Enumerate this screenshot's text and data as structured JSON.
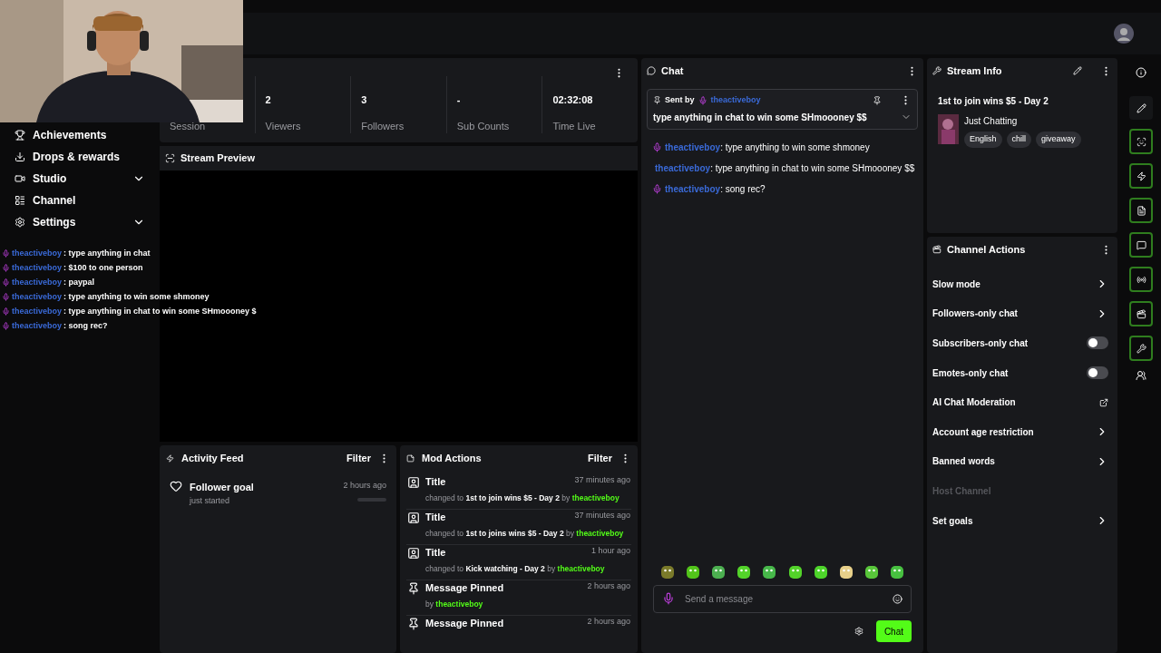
{
  "sidebar": {
    "items": [
      {
        "label": "Achievements",
        "expandable": false
      },
      {
        "label": "Drops & rewards",
        "expandable": false
      },
      {
        "label": "Studio",
        "expandable": true
      },
      {
        "label": "Channel",
        "expandable": false
      },
      {
        "label": "Settings",
        "expandable": true
      }
    ]
  },
  "overlay_chat": [
    {
      "user": "theactiveboy",
      "text": ": type anything in chat"
    },
    {
      "user": "theactiveboy",
      "text": ": $100 to one person"
    },
    {
      "user": "theactiveboy",
      "text": ": paypal"
    },
    {
      "user": "theactiveboy",
      "text": ": type anything to win some shmoney"
    },
    {
      "user": "theactiveboy",
      "text": ": type anything in chat to win some SHmoooney $"
    },
    {
      "user": "theactiveboy",
      "text": ": song rec?"
    }
  ],
  "stats": [
    {
      "label": "Session"
    },
    {
      "value": "2",
      "label": "Viewers"
    },
    {
      "value": "3",
      "label": "Followers"
    },
    {
      "value": "-",
      "label": "Sub Counts"
    },
    {
      "value": "02:32:08",
      "label": "Time Live"
    }
  ],
  "stream_preview": {
    "title": "Stream Preview"
  },
  "activity_feed": {
    "title": "Activity Feed",
    "filter": "Filter",
    "items": [
      {
        "title": "Follower goal",
        "subtitle": "just started",
        "time": "2 hours ago"
      }
    ]
  },
  "mod_actions": {
    "title": "Mod Actions",
    "filter": "Filter",
    "items": [
      {
        "kind": "title_change",
        "title": "Title",
        "time": "37 minutes ago",
        "prefix": "changed to",
        "value": "1st to join wins $5 - Day 2",
        "by": "by",
        "user": "theactiveboy"
      },
      {
        "kind": "title_change",
        "title": "Title",
        "time": "37 minutes ago",
        "prefix": "changed to",
        "value": "1st to joins wins $5 - Day 2",
        "by": "by",
        "user": "theactiveboy"
      },
      {
        "kind": "title_change",
        "title": "Title",
        "time": "1 hour ago",
        "prefix": "changed to",
        "value": "Kick watching - Day 2",
        "by": "by",
        "user": "theactiveboy"
      },
      {
        "kind": "pin",
        "title": "Message Pinned",
        "time": "2 hours ago",
        "by": "by",
        "user": "theactiveboy"
      },
      {
        "kind": "pin",
        "title": "Message Pinned",
        "time": "2 hours ago"
      }
    ]
  },
  "chat": {
    "title": "Chat",
    "pinned": {
      "label": "Sent by",
      "user": "theactiveboy",
      "text": "type anything in chat to win some SHmoooney $$"
    },
    "messages": [
      {
        "user": "theactiveboy",
        "text": ": type anything to win some shmoney"
      },
      {
        "user": "theactiveboy",
        "text": ": type anything in chat to win some SHmoooney $$"
      },
      {
        "user": "theactiveboy",
        "text": ": song rec?"
      }
    ],
    "input": {
      "placeholder": "Send a message"
    },
    "send_button": "Chat"
  },
  "stream_info": {
    "title": "Stream Info",
    "stream_title": "1st to join wins $5 - Day 2",
    "category": "Just Chatting",
    "tags": [
      "English",
      "chill",
      "giveaway"
    ]
  },
  "channel_actions": {
    "title": "Channel Actions",
    "items": [
      {
        "kind": "link",
        "label": "Slow mode",
        "disabled": false
      },
      {
        "kind": "link",
        "label": "Followers-only chat",
        "disabled": false
      },
      {
        "kind": "toggle",
        "label": "Subscribers-only chat",
        "on": false,
        "disabled": false
      },
      {
        "kind": "toggle",
        "label": "Emotes-only chat",
        "on": false,
        "disabled": false
      },
      {
        "kind": "external",
        "label": "AI Chat Moderation",
        "disabled": false
      },
      {
        "kind": "link",
        "label": "Account age restriction",
        "disabled": false
      },
      {
        "kind": "link",
        "label": "Banned words",
        "disabled": false
      },
      {
        "kind": "plain",
        "label": "Host Channel",
        "disabled": true
      },
      {
        "kind": "link",
        "label": "Set goals",
        "disabled": false
      }
    ]
  }
}
